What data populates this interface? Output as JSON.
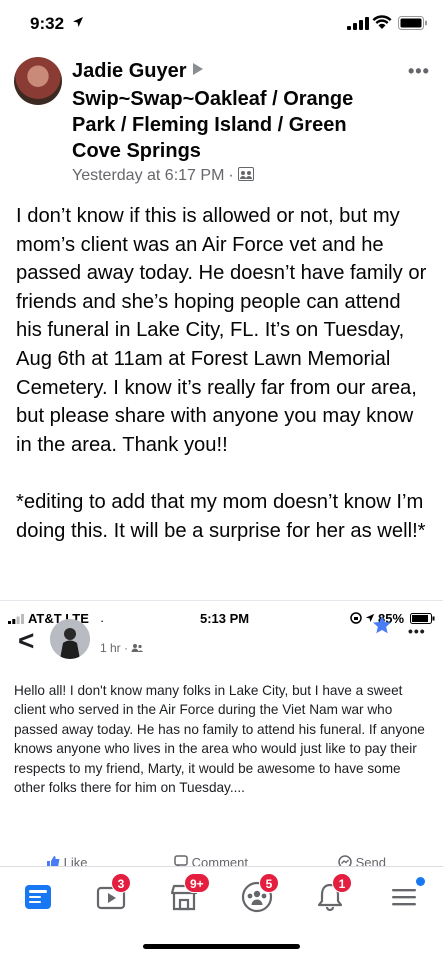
{
  "status_bar": {
    "time": "9:32"
  },
  "post": {
    "author": "Jadie Guyer",
    "group": "Swip~Swap~Oakleaf / Orange Park / Fleming Island / Green Cove Springs",
    "timestamp": "Yesterday at 6:17 PM",
    "separator": "·",
    "paragraphs": [
      "I don’t know if this is allowed or not, but my mom’s client was an Air Force vet and he passed away today. He doesn’t have family or friends and she’s hoping people can attend his funeral in Lake City, FL. It’s on Tuesday, Aug 6th at 11am at Forest Lawn Memorial Cemetery. I know it’s really far from our area, but please share with anyone you may know in the area. Thank you!!",
      "*editing to add that my mom doesn’t know I’m doing this. It will be a surprise for her as well!*"
    ],
    "more_label": "•••"
  },
  "embedded": {
    "carrier": "AT&T LTE",
    "time": "5:13 PM",
    "battery": "85%",
    "name": "·",
    "meta": "1 hr ·",
    "back": "<",
    "more_label": "•••",
    "body": "Hello all!  I don't know many folks in Lake City, but I have a sweet client who served in the Air Force during the Viet Nam war who passed away today.  He has no family to attend his funeral.  If anyone knows anyone who lives in the area who would just like to pay their respects to my friend, Marty, it would be awesome to have some other folks there for him on Tuesday....",
    "actions": [
      "Like",
      "Comment",
      "Send"
    ]
  },
  "tab_bar": {
    "items": [
      {
        "name": "news-feed",
        "badge": ""
      },
      {
        "name": "watch",
        "badge": "3"
      },
      {
        "name": "marketplace",
        "badge": "9+"
      },
      {
        "name": "groups",
        "badge": "5"
      },
      {
        "name": "notifications",
        "badge": "1"
      },
      {
        "name": "menu",
        "badge": ""
      }
    ]
  },
  "colors": {
    "accent": "#1877f2",
    "badge": "#e41e3f",
    "meta": "#65676b"
  }
}
